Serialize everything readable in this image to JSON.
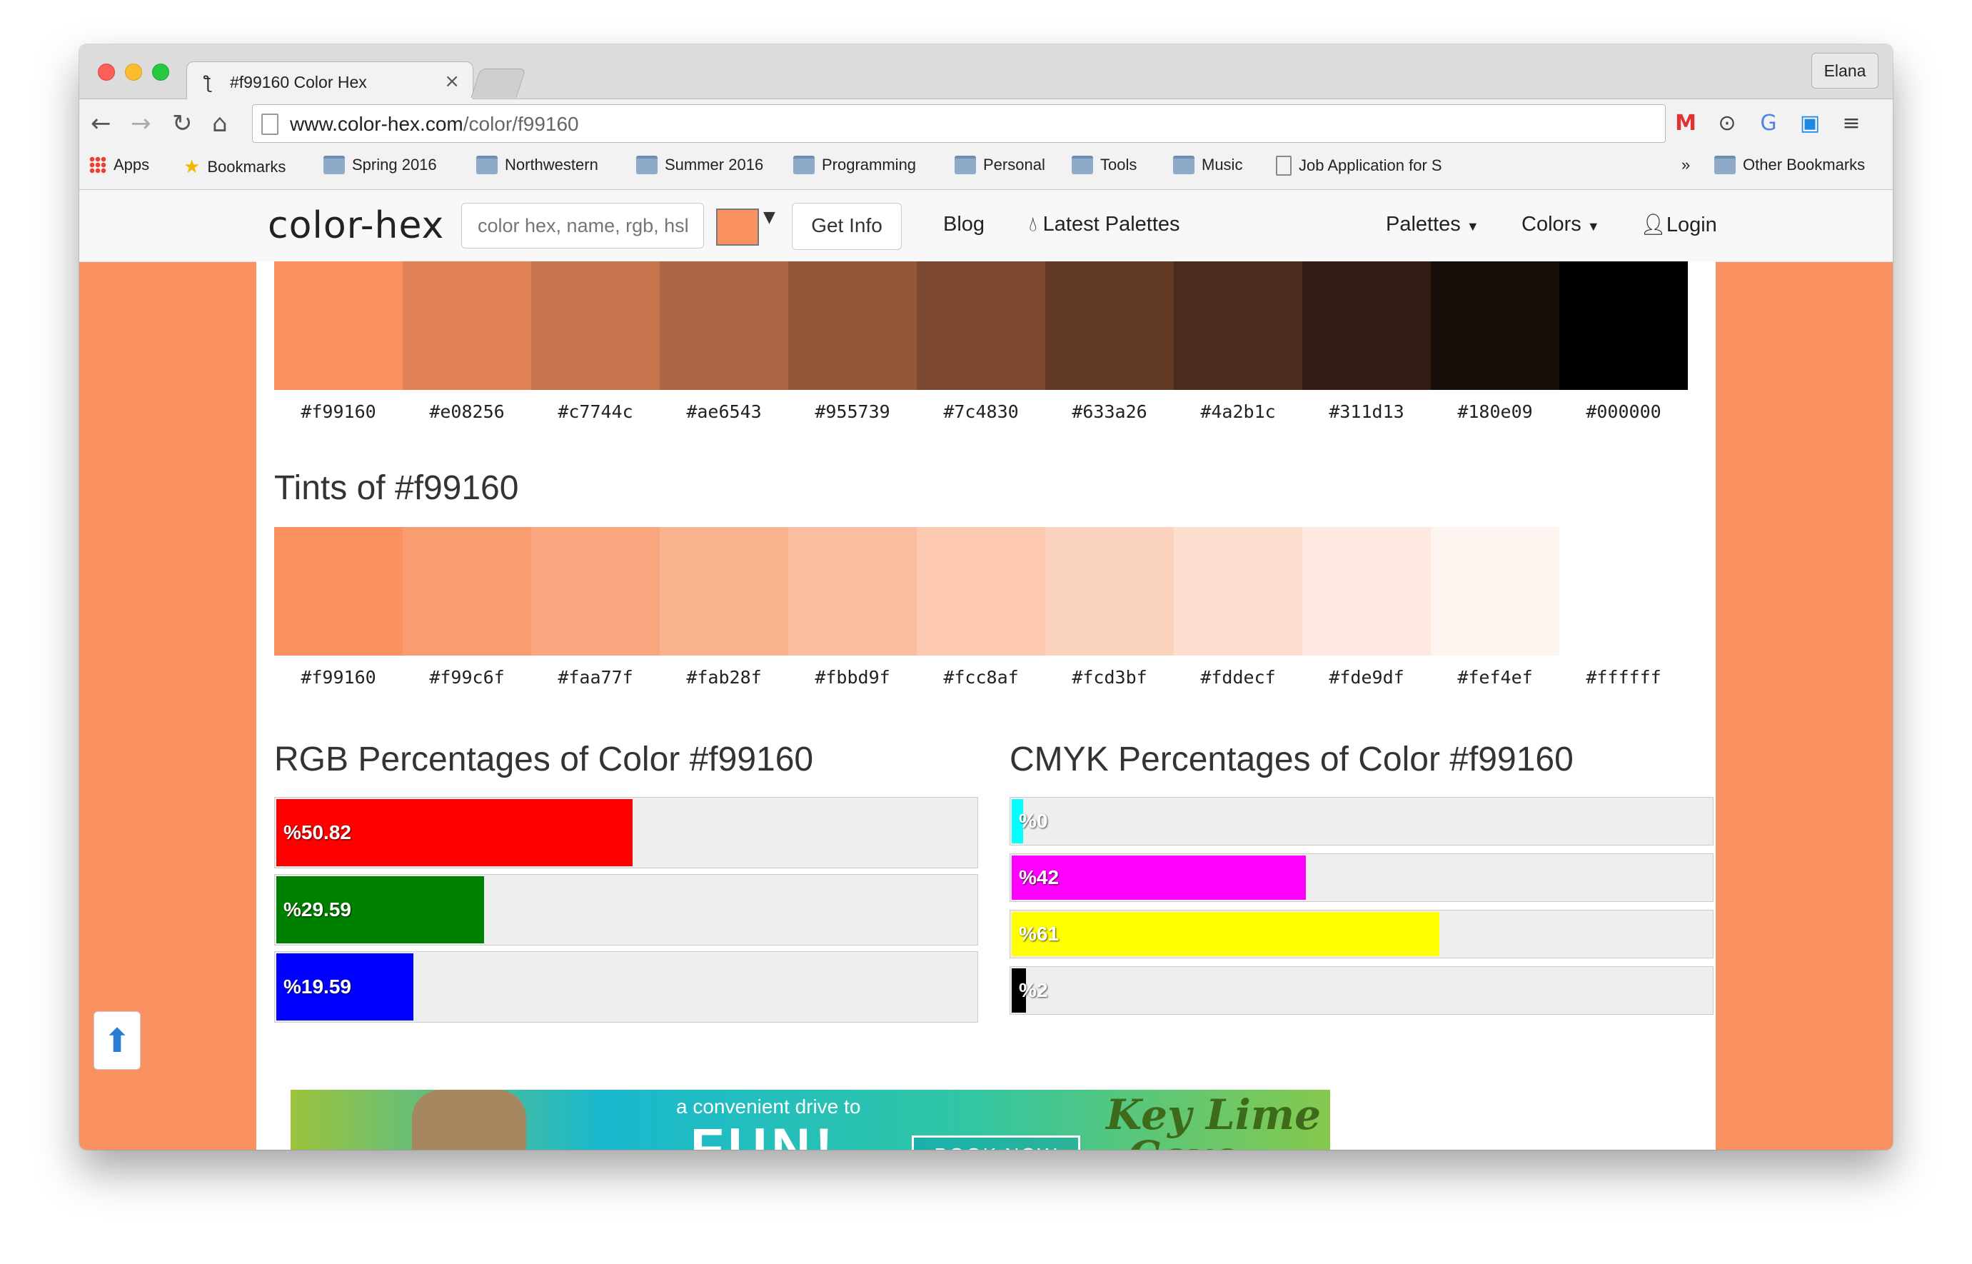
{
  "browser": {
    "tab_title": "#f99160 Color Hex",
    "tab_close": "×",
    "profile_name": "Elana",
    "url_host": "www.color-hex.com",
    "url_path": "/color/f99160",
    "bookmarks": [
      "Apps",
      "Bookmarks",
      "Spring 2016",
      "Northwestern",
      "Summer 2016",
      "Programming",
      "Personal",
      "Tools",
      "Music",
      "Job Application for S"
    ],
    "overflow": "»",
    "other_bookmarks": "Other Bookmarks"
  },
  "site": {
    "brand": "color-hex",
    "search_placeholder": "color hex, name, rgb, hsl",
    "caret": "▼",
    "get_info": "Get Info",
    "nav": {
      "blog": "Blog",
      "latest": "Latest Palettes",
      "palettes": "Palettes",
      "colors": "Colors",
      "login": "Login"
    }
  },
  "shades": {
    "colors": [
      "#f99160",
      "#e08256",
      "#c7744c",
      "#ae6543",
      "#955739",
      "#7c4830",
      "#633a26",
      "#4a2b1c",
      "#311d13",
      "#180e09",
      "#000000"
    ],
    "labels": [
      "#f99160",
      "#e08256",
      "#c7744c",
      "#ae6543",
      "#955739",
      "#7c4830",
      "#633a26",
      "#4a2b1c",
      "#311d13",
      "#180e09",
      "#000000"
    ]
  },
  "tints": {
    "title": "Tints of #f99160",
    "colors": [
      "#f99160",
      "#f99c6f",
      "#faa77f",
      "#fab28f",
      "#fbbd9f",
      "#fcc8af",
      "#fcd3bf",
      "#fddecf",
      "#fde9df",
      "#fef4ef",
      "#ffffff"
    ],
    "labels": [
      "#f99160",
      "#f99c6f",
      "#faa77f",
      "#fab28f",
      "#fbbd9f",
      "#fcc8af",
      "#fcd3bf",
      "#fddecf",
      "#fde9df",
      "#fef4ef",
      "#ffffff"
    ]
  },
  "rgb": {
    "title": "RGB Percentages of Color #f99160",
    "bars": [
      {
        "label": "%50.82",
        "value": 50.82,
        "color": "#ff0000"
      },
      {
        "label": "%29.59",
        "value": 29.59,
        "color": "#008000"
      },
      {
        "label": "%19.59",
        "value": 19.59,
        "color": "#0000ff"
      }
    ]
  },
  "cmyk": {
    "title": "CMYK Percentages of Color #f99160",
    "bars": [
      {
        "label": "%0",
        "value": 0,
        "color": "#00ffff"
      },
      {
        "label": "%42",
        "value": 42,
        "color": "#ff00ff"
      },
      {
        "label": "%61",
        "value": 61,
        "color": "#ffff00"
      },
      {
        "label": "%2",
        "value": 2,
        "color": "#000000"
      }
    ]
  },
  "ad": {
    "line1": "a convenient drive to",
    "line2": "FUN!",
    "button": "BOOK NOW",
    "logo1": "Key Lime",
    "logo2": "Cove"
  },
  "back_to_top": "⬆"
}
